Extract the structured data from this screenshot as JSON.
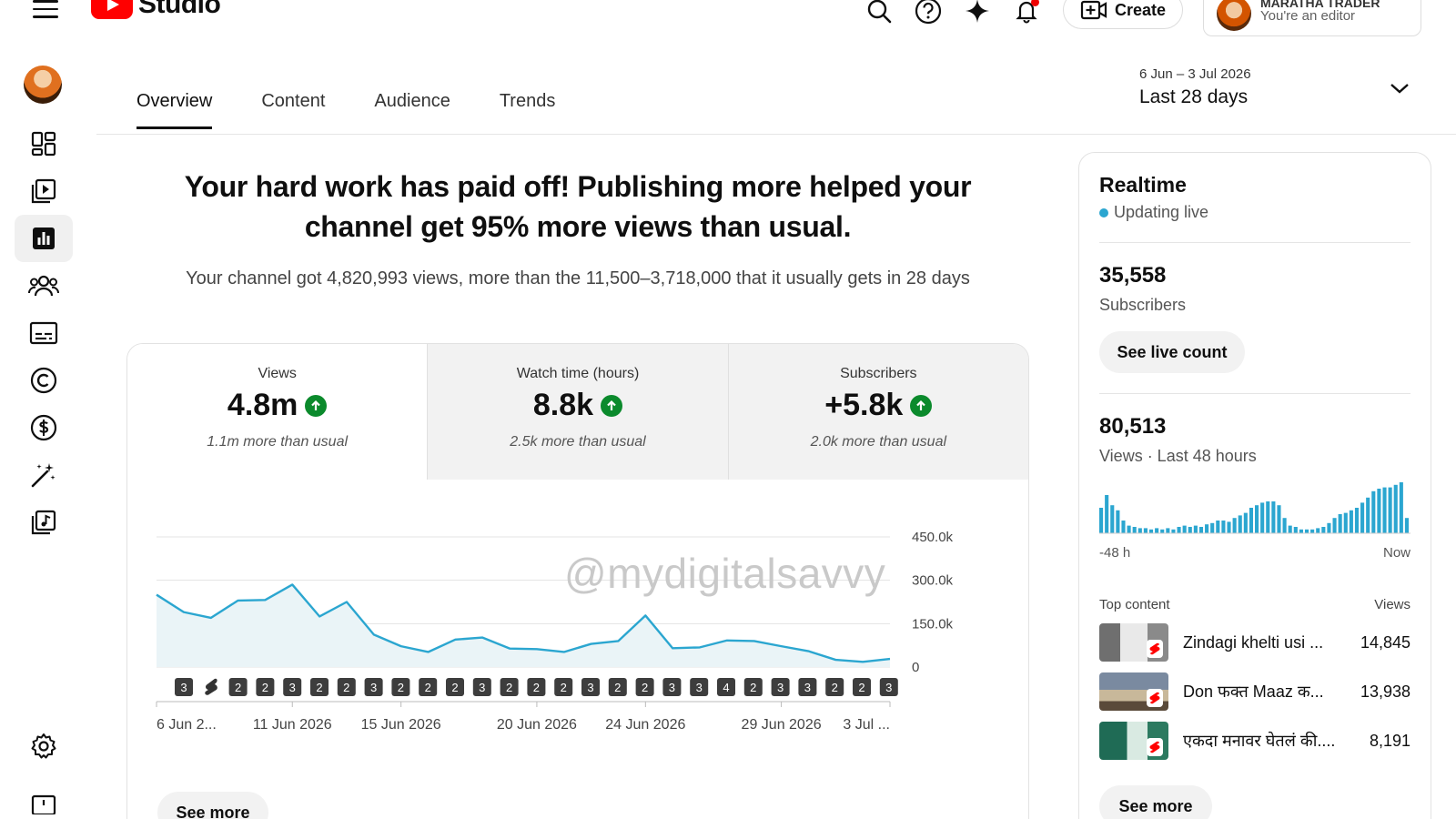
{
  "app": {
    "logo_text": "Studio",
    "create_label": "Create",
    "account_name": "MARATHA TRADER",
    "account_role": "You're an editor"
  },
  "icons": {
    "menu": "hamburger-icon",
    "search": "search-icon",
    "help": "help-icon",
    "sparkle": "sparkle-icon",
    "bell": "bell-icon",
    "create": "video-plus-icon"
  },
  "sidebar": {
    "items": [
      {
        "name": "dashboard",
        "icon": "dashboard-icon"
      },
      {
        "name": "content",
        "icon": "content-icon"
      },
      {
        "name": "analytics",
        "icon": "analytics-icon",
        "active": true
      },
      {
        "name": "community",
        "icon": "community-icon"
      },
      {
        "name": "subtitles",
        "icon": "subtitles-icon"
      },
      {
        "name": "copyright",
        "icon": "copyright-icon"
      },
      {
        "name": "earn",
        "icon": "earn-icon"
      },
      {
        "name": "customisation",
        "icon": "magic-wand-icon"
      },
      {
        "name": "audio-library",
        "icon": "audio-library-icon"
      },
      {
        "name": "settings",
        "icon": "settings-icon"
      }
    ]
  },
  "tabs": [
    "Overview",
    "Content",
    "Audience",
    "Trends"
  ],
  "date_range": {
    "range": "6 Jun – 3 Jul 2026",
    "label": "Last 28 days"
  },
  "headline": "Your hard work has paid off! Publishing more helped your channel get 95% more views than usual.",
  "subline": "Your channel got 4,820,993 views, more than the 11,500–3,718,000 that it usually gets in 28 days",
  "metrics": [
    {
      "label": "Views",
      "value": "4.8m",
      "note": "1.1m more than usual"
    },
    {
      "label": "Watch time (hours)",
      "value": "8.8k",
      "note": "2.5k more than usual"
    },
    {
      "label": "Subscribers",
      "value": "+5.8k",
      "note": "2.0k more than usual"
    }
  ],
  "watermark": "@mydigitalsavvy",
  "see_more": "See more",
  "chart_data": {
    "type": "area",
    "series": [
      {
        "values": [
          250,
          190,
          170,
          230,
          232,
          285,
          175,
          225,
          112,
          72,
          52,
          95,
          102,
          64,
          62,
          52,
          80,
          90,
          178,
          65,
          68,
          92,
          90,
          72,
          55,
          25,
          18,
          28
        ]
      }
    ],
    "y_ticks": [
      "450.0k",
      "300.0k",
      "150.0k",
      "0"
    ],
    "ylim": [
      0,
      450
    ],
    "x_labels": [
      "6 Jun 2...",
      "11 Jun 2026",
      "15 Jun 2026",
      "20 Jun 2026",
      "24 Jun 2026",
      "29 Jun 2026",
      "3 Jul ..."
    ],
    "x_label_day_index": [
      0,
      5,
      9,
      14,
      18,
      23,
      27
    ],
    "publish_markers": [
      "3",
      "shorts",
      "2",
      "2",
      "3",
      "2",
      "2",
      "3",
      "2",
      "2",
      "2",
      "3",
      "2",
      "2",
      "2",
      "3",
      "2",
      "2",
      "3",
      "3",
      "4",
      "2",
      "3",
      "3",
      "2",
      "2",
      "3"
    ],
    "line_color": "#2ba6d0",
    "fill_color": "#eaf4f7"
  },
  "realtime": {
    "title": "Realtime",
    "status": "Updating live",
    "subscribers_value": "35,558",
    "subscribers_label": "Subscribers",
    "live_count_label": "See live count",
    "views_value": "80,513",
    "views_label": "Views · Last 48 hours",
    "axis_start": "-48 h",
    "axis_end": "Now",
    "bars": [
      20,
      30,
      22,
      18,
      10,
      6,
      5,
      4,
      4,
      3,
      4,
      3,
      4,
      3,
      5,
      6,
      5,
      6,
      5,
      7,
      8,
      10,
      10,
      9,
      12,
      14,
      16,
      20,
      22,
      24,
      25,
      25,
      22,
      12,
      6,
      5,
      3,
      3,
      3,
      4,
      5,
      8,
      12,
      15,
      16,
      18,
      20,
      24,
      28,
      33,
      35,
      36,
      36,
      38,
      40,
      12
    ],
    "top_content_label": "Top content",
    "top_content_views_label": "Views",
    "top_content": [
      {
        "title": "Zindagi khelti usi ...",
        "views": "14,845"
      },
      {
        "title": "Don फक्त Maaz क...",
        "views": "13,938"
      },
      {
        "title": "एकदा मनावर घेतलं की....",
        "views": "8,191"
      }
    ],
    "see_more": "See more"
  }
}
